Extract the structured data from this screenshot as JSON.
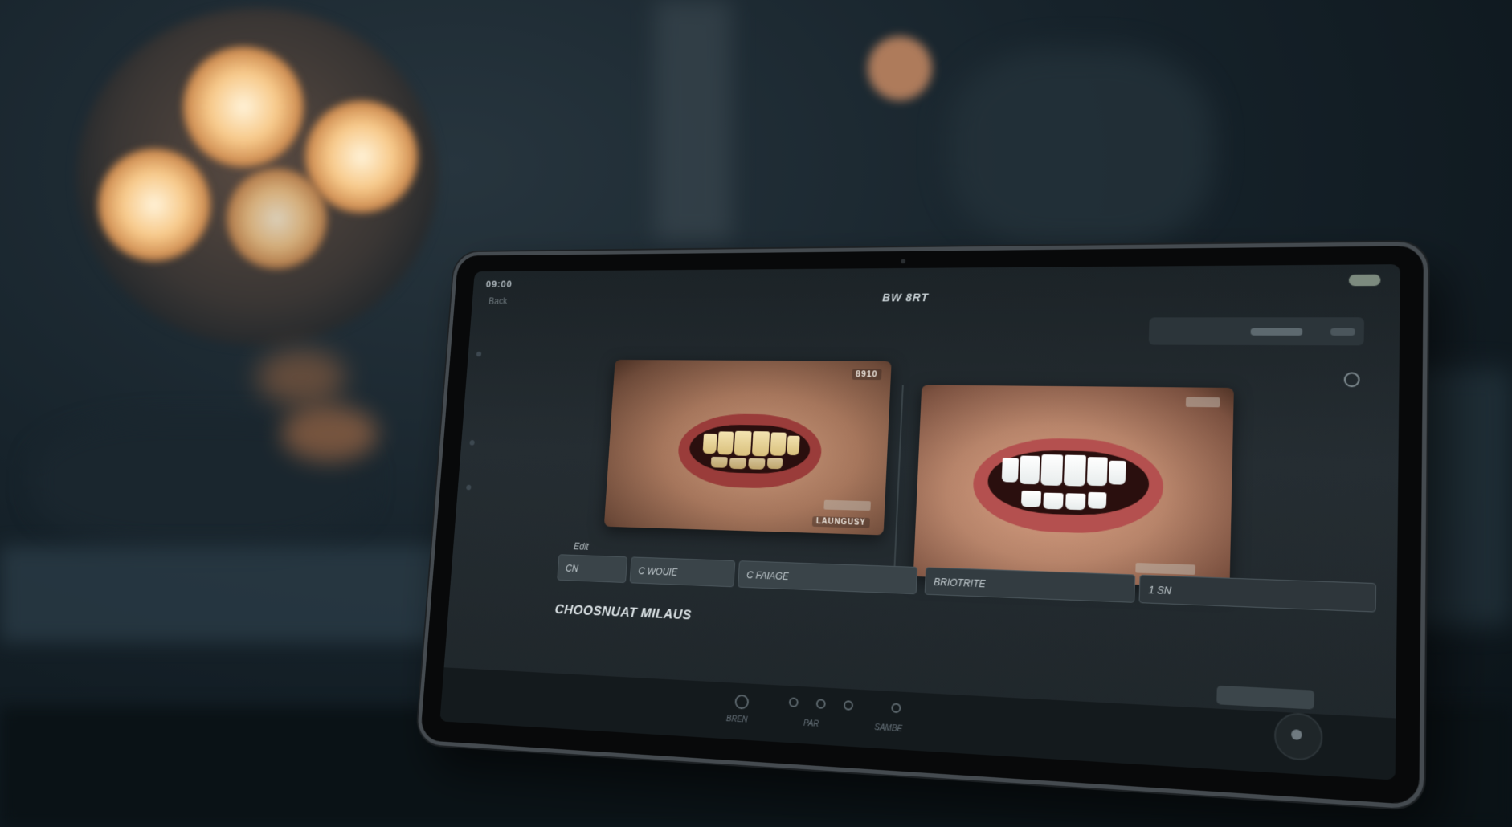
{
  "scene": {
    "description_tags": [
      "dental-clinic",
      "tablet",
      "smile-comparison"
    ]
  },
  "screen": {
    "status_time": "09:00",
    "back_label": "Back",
    "app_title": "BW 8RT",
    "before_label": "8910",
    "before_caption": "LAUNGUSY",
    "after_label": "",
    "after_caption": "",
    "edit_label": "Edit",
    "toolbar": {
      "seg1": "CN",
      "seg2": "C WOUIE",
      "seg3": "C FAIAGE",
      "seg4": "BRIOTRITE",
      "seg5": "1 SN"
    },
    "section_title": "CHOOSNUAT MILAUS",
    "corner_button": "",
    "dock": {
      "label1": "BREN",
      "label2": "PAR",
      "label3": "SAMBE"
    }
  },
  "colors": {
    "lamp_glow": "#f7c98a",
    "screen_bg": "#1c2327",
    "lip": "#9a3c3a"
  }
}
